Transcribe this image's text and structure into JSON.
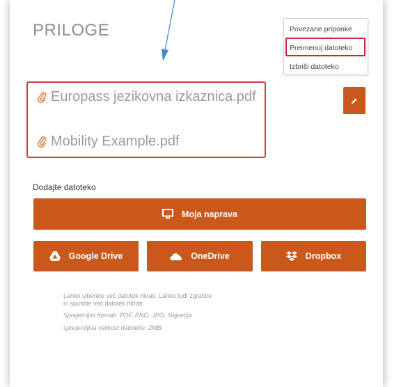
{
  "section": {
    "title": "PRILOGE"
  },
  "context_menu": {
    "items": [
      {
        "label": "Povezane priponke"
      },
      {
        "label": "Preimenuj datoteko"
      },
      {
        "label": "Izbriši datoteko"
      }
    ]
  },
  "files": [
    {
      "name": "Europass jezikovna izkaznica.pdf",
      "icon": "paperclip-icon"
    },
    {
      "name": "Mobility Example.pdf",
      "icon": "paperclip-icon"
    }
  ],
  "upload": {
    "label": "Dodajte datoteko",
    "device_button": "Moja naprava",
    "google_drive_button": "Google Drive",
    "onedrive_button": "OneDrive",
    "dropbox_button": "Dropbox",
    "note_line1": "Lahko izberete več datotek hkrati. Lahko tudi zgrabite",
    "note_line2": "in spustite več datotek hkrati.",
    "formats_line1": "Sprejemljivi formati: PDF, PNG, JPG. Največja",
    "formats_line2": "sprejemljiva velikost datoteke: 2MB."
  },
  "colors": {
    "accent": "#c9581a",
    "highlight_border": "#d63a48",
    "arrow": "#4a86d6",
    "text_muted": "#9a9a9a"
  }
}
